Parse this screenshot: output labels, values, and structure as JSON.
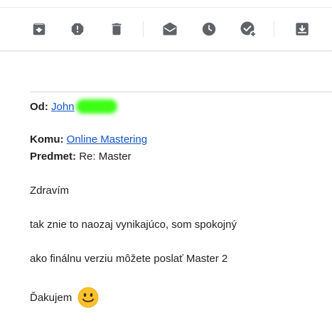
{
  "toolbar": {
    "icons": [
      "archive-icon",
      "report-spam-icon",
      "delete-icon",
      "mark-as-read-icon",
      "snooze-icon",
      "add-to-tasks-icon",
      "move-to-icon"
    ]
  },
  "email": {
    "from_label": "Od:",
    "from_name": "John",
    "to_label": "Komu:",
    "to_name": "Online Mastering",
    "subject_label": "Predmet:",
    "subject": "Re: Master",
    "body": {
      "greeting": "Zdravím",
      "line1": "tak znie to naozaj vynikajúco, som spokojný",
      "line2": "ako finálnu verziu môžete poslať Master 2",
      "closing": "Ďakujem"
    }
  },
  "colors": {
    "icon": "#5f6368",
    "link": "#1155cc",
    "redaction": "#3cff14",
    "emoji": "#fbc02d"
  }
}
